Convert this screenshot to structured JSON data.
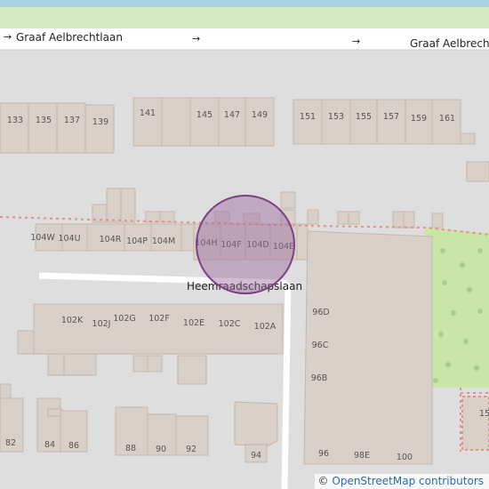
{
  "map": {
    "streets": {
      "top": "Graaf Aelbrechtlaan",
      "middle": "Heemraadschapslaan"
    },
    "oneway_arrow": "→",
    "house_numbers": {
      "top_row": [
        "133",
        "135",
        "137",
        "139",
        "141",
        "145",
        "147",
        "149",
        "151",
        "153",
        "155",
        "157",
        "159",
        "161"
      ],
      "mid_row": [
        "104W",
        "104U",
        "104R",
        "104P",
        "104M",
        "104H",
        "104F",
        "104D",
        "104E"
      ],
      "lower_row": [
        "102K",
        "102J",
        "102G",
        "102F",
        "102E",
        "102C",
        "102A"
      ],
      "tall_building": [
        "96D",
        "96C",
        "96B"
      ],
      "bottom_row": [
        "82",
        "84",
        "86",
        "88",
        "90",
        "92",
        "94",
        "96",
        "98E",
        "100"
      ],
      "right_edge": "15"
    },
    "marker": {
      "type": "circle",
      "fill": "#9b6a9e",
      "stroke": "#7e3f84"
    },
    "colors": {
      "background": "#dedede",
      "building": "#d9d0c9",
      "building_outline": "#c5b7ab",
      "road": "#ffffff",
      "park": "#c8e6a5",
      "water": "#aad3df"
    }
  },
  "attribution": {
    "symbol": "©",
    "text": "OpenStreetMap contributors"
  }
}
